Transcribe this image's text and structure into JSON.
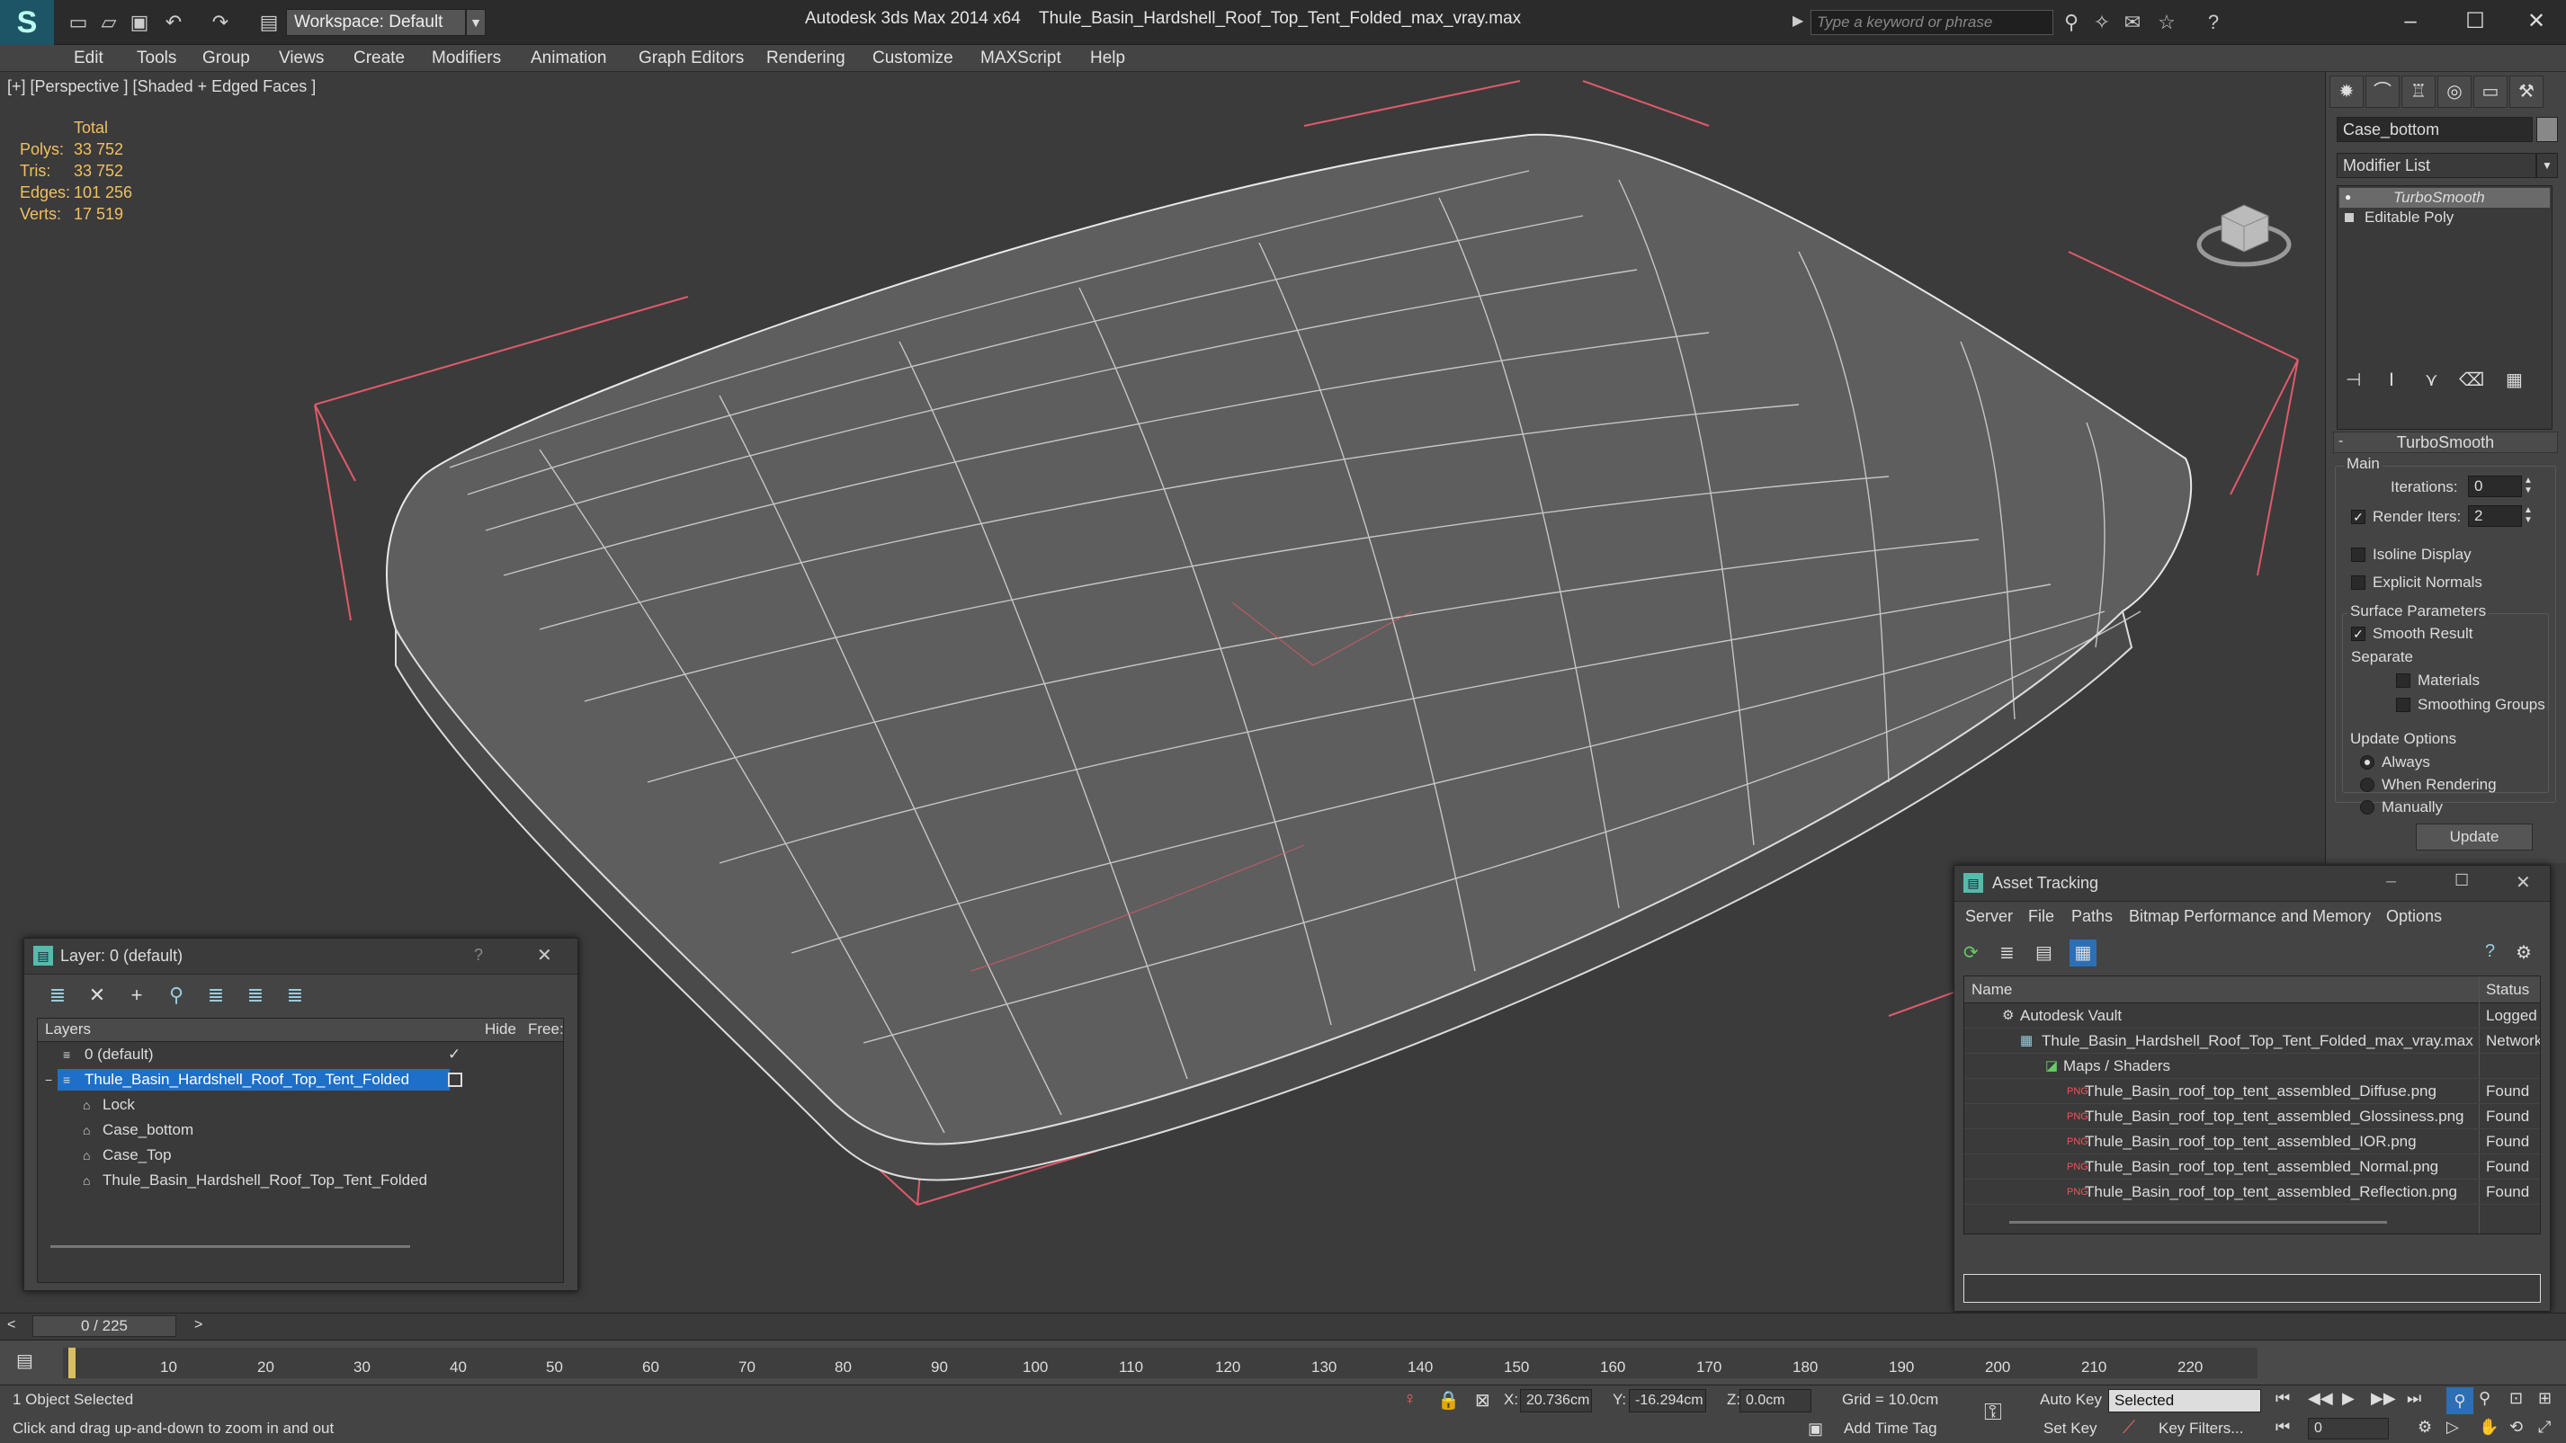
{
  "titlebar": {
    "workspace": "Workspace: Default",
    "app_title": "Autodesk 3ds Max  2014 x64",
    "file_title": "Thule_Basin_Hardshell_Roof_Top_Tent_Folded_max_vray.max",
    "search_placeholder": "Type a keyword or phrase"
  },
  "menu": [
    "Edit",
    "Tools",
    "Group",
    "Views",
    "Create",
    "Modifiers",
    "Animation",
    "Graph Editors",
    "Rendering",
    "Customize",
    "MAXScript",
    "Help"
  ],
  "viewport": {
    "label": "[+] [Perspective ] [Shaded + Edged Faces ]",
    "stats": {
      "total_label": "Total",
      "rows": [
        {
          "k": "Polys:",
          "v": "33 752"
        },
        {
          "k": "Tris:",
          "v": "33 752"
        },
        {
          "k": "Edges:",
          "v": "101 256"
        },
        {
          "k": "Verts:",
          "v": "17 519"
        }
      ]
    }
  },
  "command_panel": {
    "object_name": "Case_bottom",
    "modifier_list": "Modifier List",
    "stack": [
      "TurboSmooth",
      "Editable Poly"
    ],
    "rollout_title": "TurboSmooth",
    "main_group": "Main",
    "iterations_label": "Iterations:",
    "iterations_value": "0",
    "render_iters_label": "Render Iters:",
    "render_iters_value": "2",
    "isoline_display": "Isoline Display",
    "explicit_normals": "Explicit Normals",
    "surface_params": "Surface Parameters",
    "smooth_result": "Smooth Result",
    "separate": "Separate",
    "materials": "Materials",
    "smoothing_groups": "Smoothing Groups",
    "update_options": "Update Options",
    "always": "Always",
    "when_rendering": "When Rendering",
    "manually": "Manually",
    "update_button": "Update"
  },
  "layer_window": {
    "title": "Layer: 0 (default)",
    "help": "?",
    "col_layers": "Layers",
    "col_hide": "Hide",
    "col_freeze": "Free:",
    "rows": [
      {
        "name": "0 (default)",
        "indent": 0
      },
      {
        "name": "Thule_Basin_Hardshell_Roof_Top_Tent_Folded",
        "indent": 0,
        "selected": true
      },
      {
        "name": "Lock",
        "indent": 1
      },
      {
        "name": "Case_bottom",
        "indent": 1
      },
      {
        "name": "Case_Top",
        "indent": 1
      },
      {
        "name": "Thule_Basin_Hardshell_Roof_Top_Tent_Folded",
        "indent": 1
      }
    ]
  },
  "asset_tracking": {
    "title": "Asset Tracking",
    "menu": [
      "Server",
      "File",
      "Paths",
      "Bitmap Performance and Memory",
      "Options"
    ],
    "col_name": "Name",
    "col_status": "Status",
    "rows": [
      {
        "name": "Autodesk Vault",
        "status": "Logged",
        "indent": 1
      },
      {
        "name": "Thule_Basin_Hardshell_Roof_Top_Tent_Folded_max_vray.max",
        "status": "Network",
        "indent": 2
      },
      {
        "name": "Maps / Shaders",
        "status": "",
        "indent": 3
      },
      {
        "name": "Thule_Basin_roof_top_tent_assembled_Diffuse.png",
        "status": "Found",
        "indent": 4
      },
      {
        "name": "Thule_Basin_roof_top_tent_assembled_Glossiness.png",
        "status": "Found",
        "indent": 4
      },
      {
        "name": "Thule_Basin_roof_top_tent_assembled_IOR.png",
        "status": "Found",
        "indent": 4
      },
      {
        "name": "Thule_Basin_roof_top_tent_assembled_Normal.png",
        "status": "Found",
        "indent": 4
      },
      {
        "name": "Thule_Basin_roof_top_tent_assembled_Reflection.png",
        "status": "Found",
        "indent": 4
      }
    ]
  },
  "timeline": {
    "frame": "0 / 225",
    "ticks": [
      "10",
      "20",
      "30",
      "40",
      "50",
      "60",
      "70",
      "80",
      "90",
      "100",
      "110",
      "120",
      "130",
      "140",
      "150",
      "160",
      "170",
      "180",
      "190",
      "200",
      "210",
      "220"
    ]
  },
  "status": {
    "selected": "1 Object Selected",
    "prompt": "Click and drag up-and-down to zoom in and out",
    "x_label": "X:",
    "x_value": "20.736cm",
    "y_label": "Y:",
    "y_value": "-16.294cm",
    "z_label": "Z:",
    "z_value": "0.0cm",
    "grid": "Grid = 10.0cm",
    "add_time_tag": "Add Time Tag",
    "auto_key": "Auto Key",
    "set_key": "Set Key",
    "selected_dropdown": "Selected",
    "key_filters": "Key Filters...",
    "frame_field": "0"
  }
}
